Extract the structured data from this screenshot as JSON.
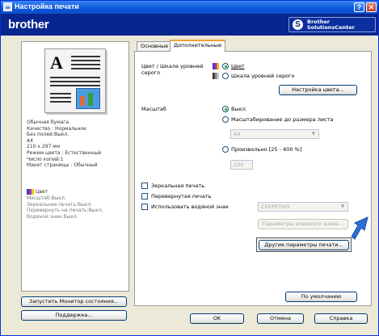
{
  "window": {
    "title": "Настройка печати",
    "help": "?",
    "close": "✕"
  },
  "brand": {
    "logo": "brother",
    "solutions_line1": "Brother",
    "solutions_line2": "SolutionsCenter"
  },
  "summary": {
    "lines": [
      "Обычная бумага",
      "Качество : Нормальное",
      "Без полей:Выкл.",
      "A4",
      "210 x 297 мм",
      "Режим цвета : Естественный",
      "Число копий:1",
      "Макет страницы : Обычный"
    ],
    "color_label": "Цвет",
    "dim_lines": [
      "Масштаб:Выкл.",
      "Зеркальная печать:Выкл.",
      "Перевернуть на печать:Выкл.",
      "Водяной знак:Выкл."
    ]
  },
  "left_buttons": {
    "monitor": "Запустить Монитор состояния...",
    "support": "Поддержка..."
  },
  "tabs": [
    {
      "label": "Основные"
    },
    {
      "label": "Дополнительные"
    }
  ],
  "color": {
    "label_line1": "Цвет / Шкала уровней",
    "label_line2": "серого",
    "option_color": "Цвет",
    "option_gray": "Шкала уровней серого",
    "settings_button": "Настройка цвета..."
  },
  "scale": {
    "label": "Масштаб",
    "off": "Выкл.",
    "fit": "Масштабирование до размера листа",
    "fit_value": "A4",
    "free": "Произвольно [25 - 400 %]",
    "free_value": "100"
  },
  "options": {
    "mirror": "Зеркальная печать",
    "reverse": "Перевернутая печать",
    "watermark": "Использовать водяной знак",
    "watermark_value": "СЕКРЕТНО",
    "watermark_params": "Параметры водяного знака...",
    "other_params": "Другие параметры печати..."
  },
  "tab_buttons": {
    "default": "По умолчанию"
  },
  "dialog_buttons": {
    "ok": "OK",
    "cancel": "Отмена",
    "help": "Справка"
  },
  "colors": {
    "title_bar": "#0a57d8",
    "brand_bar": "#08268e",
    "pointer": "#2a6fd6"
  }
}
